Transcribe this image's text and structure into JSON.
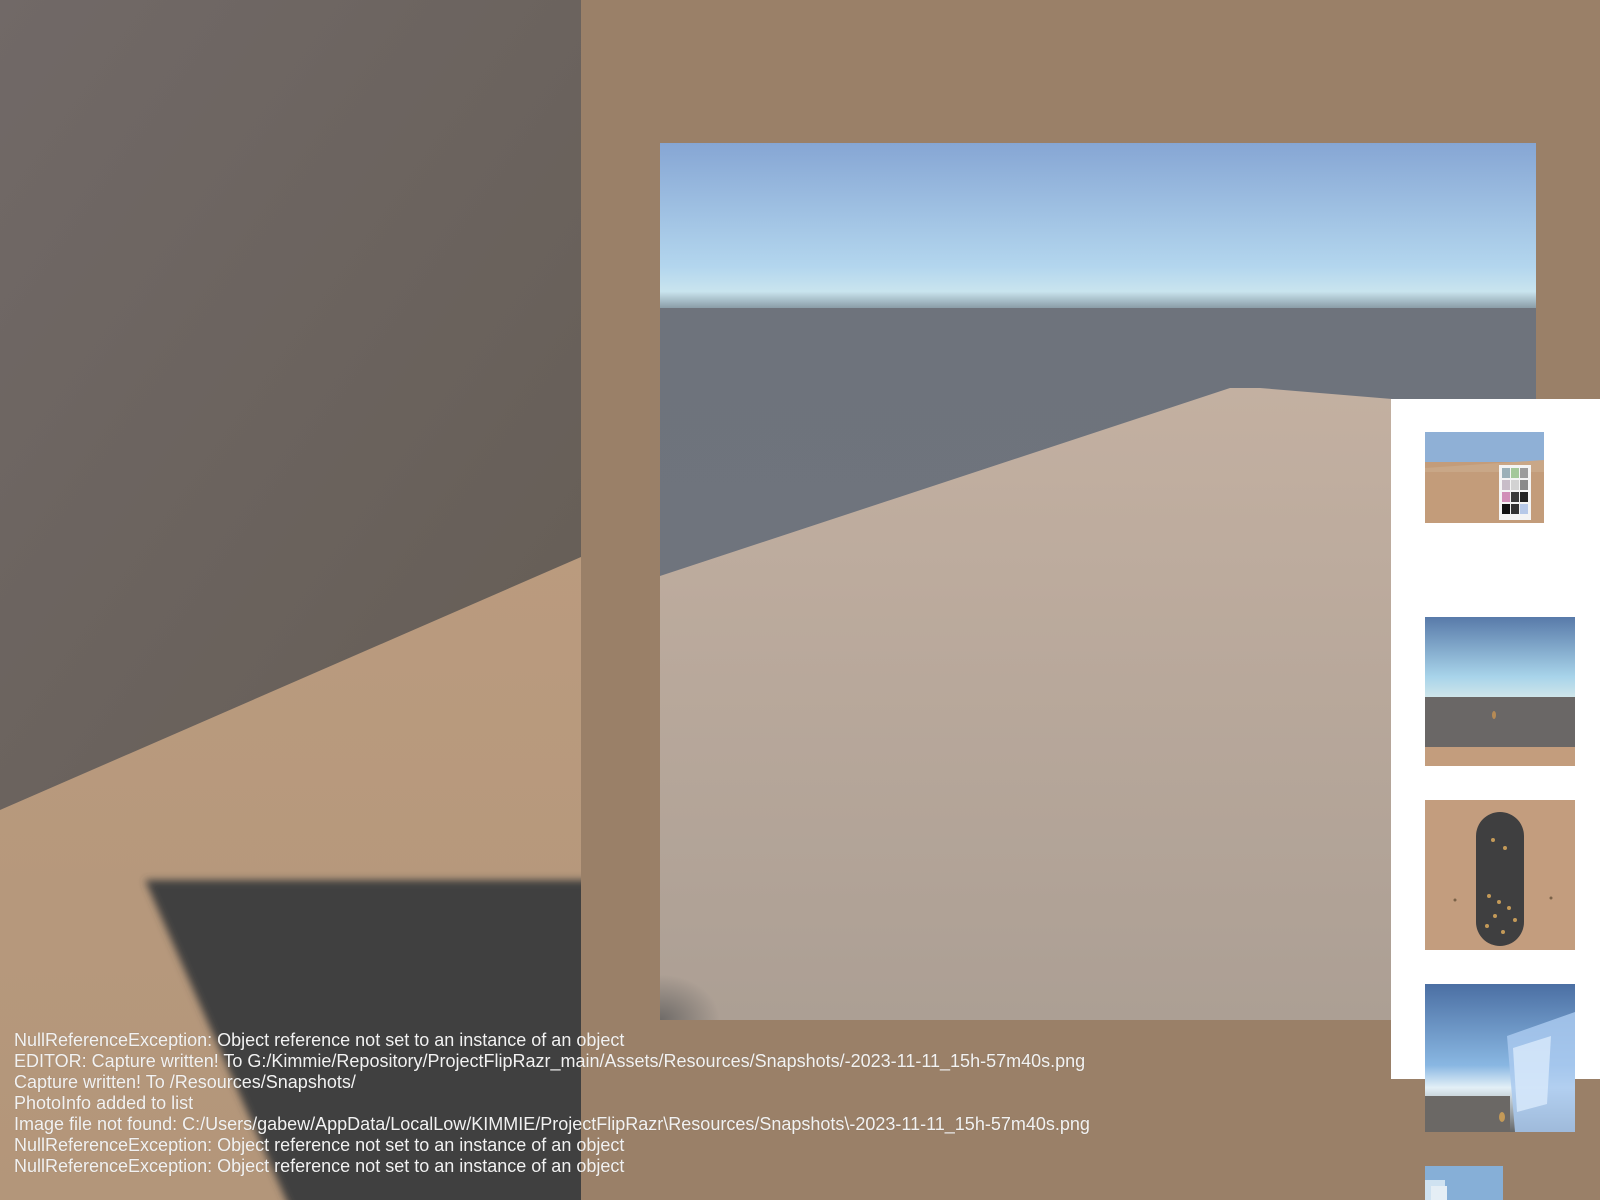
{
  "console_log": {
    "lines": [
      "NullReferenceException: Object reference not set to an instance of an object",
      "EDITOR: Capture written! To G:/Kimmie/Repository/ProjectFlipRazr_main/Assets/Resources/Snapshots/-2023-11-11_15h-57m40s.png",
      "Capture written! To /Resources/Snapshots/",
      "PhotoInfo added to list",
      "Image file not found: C:/Users/gabew/AppData/LocalLow/KIMMIE/ProjectFlipRazr\\Resources/Snapshots\\-2023-11-11_15h-57m40s.png",
      "NullReferenceException: Object reference not set to an instance of an object",
      "NullReferenceException: Object reference not set to an instance of an object"
    ]
  },
  "colors": {
    "background": "#9a8068",
    "sky": "#9fbce2",
    "ground": "#bd9d7e",
    "wall": "#6b6560",
    "shadow": "#414141",
    "sidebar": "#ffffff"
  },
  "snapshot_gallery": {
    "count": 5
  }
}
